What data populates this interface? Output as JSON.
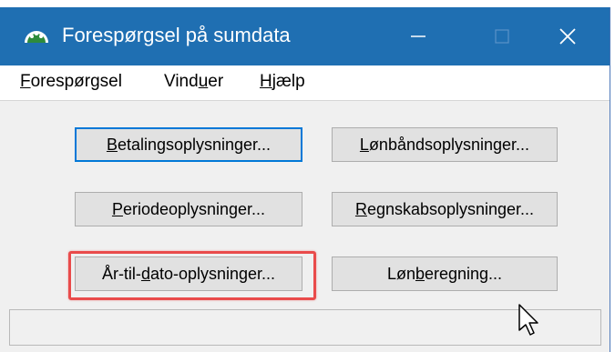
{
  "window": {
    "title": "Forespørgsel på sumdata",
    "colors": {
      "titlebar": "#1f6fb2",
      "highlight": "#e94b4b",
      "default_button_border": "#0078d7"
    },
    "controls": {
      "minimize_icon": "minimize-icon",
      "maximize_icon": "maximize-icon",
      "close_icon": "close-icon"
    }
  },
  "menu": {
    "items": [
      {
        "accel": "F",
        "rest": "orespørgsel"
      },
      {
        "pre": "Vind",
        "accel": "u",
        "rest": "er"
      },
      {
        "accel": "H",
        "rest": "jælp"
      }
    ]
  },
  "buttons": {
    "betaling": {
      "accel": "B",
      "rest": "etalingsoplysninger..."
    },
    "lonbaand": {
      "accel": "L",
      "rest": "ønbåndsoplysninger..."
    },
    "periode": {
      "accel": "P",
      "rest": "eriodeoplysninger..."
    },
    "regnskab": {
      "accel": "R",
      "rest": "egnskabsoplysninger..."
    },
    "aartildato": {
      "pre": "År-til-",
      "accel": "d",
      "rest": "ato-oplysninger..."
    },
    "lonberegning": {
      "pre": "Løn",
      "accel": "b",
      "rest": "eregning..."
    }
  },
  "statusbar": {
    "text": ""
  }
}
